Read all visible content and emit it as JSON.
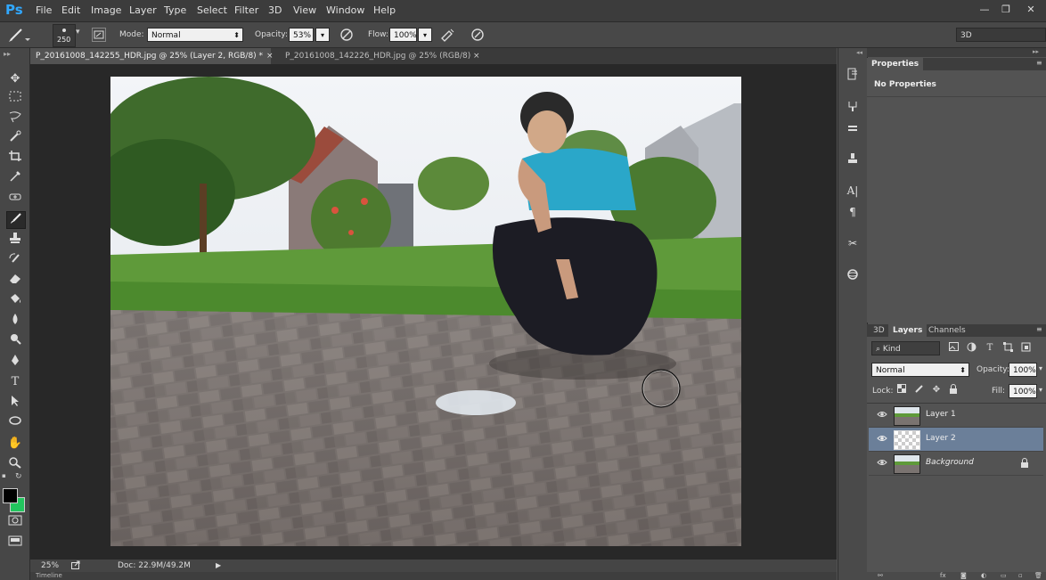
{
  "app": {
    "logo": "Ps"
  },
  "menu": {
    "items": [
      "File",
      "Edit",
      "Image",
      "Layer",
      "Type",
      "Select",
      "Filter",
      "3D",
      "View",
      "Window",
      "Help"
    ]
  },
  "window_controls": {
    "minimize": "—",
    "restore": "❐",
    "close": "✕"
  },
  "options": {
    "brush_size": "250",
    "mode_label": "Mode:",
    "mode_value": "Normal",
    "opacity_label": "Opacity:",
    "opacity_value": "53%",
    "flow_label": "Flow:",
    "flow_value": "100%",
    "workspace": "3D"
  },
  "tabs": [
    {
      "label": "P_20161008_142255_HDR.jpg @ 25% (Layer 2, RGB/8) *",
      "active": true
    },
    {
      "label": "P_20161008_142226_HDR.jpg @ 25% (RGB/8)",
      "active": false
    }
  ],
  "tab_close": "×",
  "status": {
    "zoom": "25%",
    "doc": "Doc: 22.9M/49.2M"
  },
  "properties": {
    "tab": "Properties",
    "empty": "No Properties"
  },
  "layers_panel": {
    "tabs": [
      "3D",
      "Layers",
      "Channels"
    ],
    "filter_kind": "Kind",
    "blend_mode": "Normal",
    "opacity_label": "Opacity:",
    "opacity_value": "100%",
    "lock_label": "Lock:",
    "fill_label": "Fill:",
    "fill_value": "100%",
    "layers": [
      {
        "name": "Layer 1",
        "selected": false,
        "locked": false
      },
      {
        "name": "Layer 2",
        "selected": true,
        "locked": false
      },
      {
        "name": "Background",
        "selected": false,
        "locked": true
      }
    ]
  },
  "timeline_label": "Timeline",
  "colors": {
    "foreground": "#000000",
    "background": "#22c55e",
    "selected_layer": "#6b7f99"
  }
}
